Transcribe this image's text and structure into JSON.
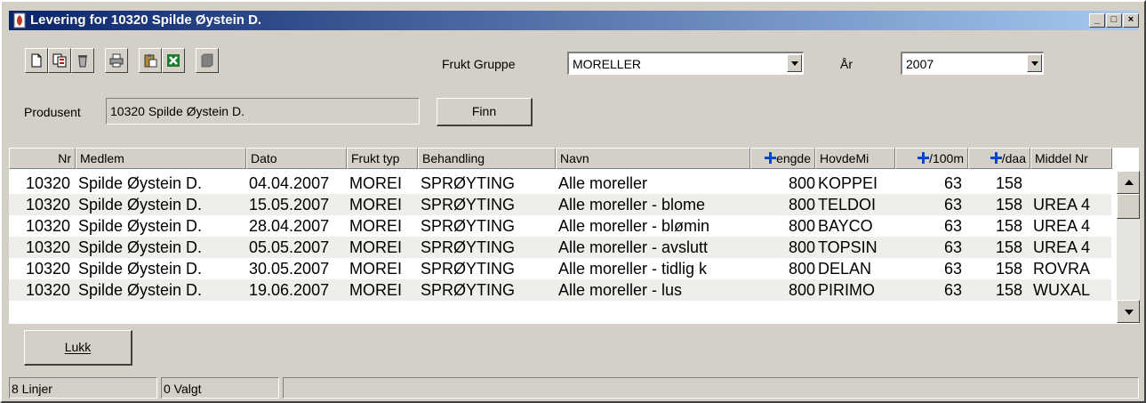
{
  "window": {
    "title": "Levering for 10320 Spilde Øystein D."
  },
  "toolbar": {
    "icons": [
      "new-document-icon",
      "copy-icon",
      "delete-icon",
      "print-icon",
      "paste-icon",
      "excel-icon",
      "stop-icon"
    ]
  },
  "filters": {
    "frukt_gruppe_label": "Frukt Gruppe",
    "frukt_gruppe_value": "MORELLER",
    "aar_label": "År",
    "aar_value": "2007",
    "produsent_label": "Produsent",
    "produsent_value": "10320 Spilde Øystein D.",
    "finn_label": "Finn"
  },
  "grid": {
    "columns": [
      "Nr",
      "Medlem",
      "Dato",
      "Frukt typ",
      "Behandling",
      "Navn",
      "engde",
      "HovdeMi",
      "/100m",
      "/daa",
      "Middel Nr"
    ],
    "rows": [
      [
        "10320",
        "Spilde Øystein D.",
        "04.04.2007",
        "MOREI",
        "SPRØYTING",
        "Alle moreller",
        "800",
        "KOPPEI",
        "63",
        "158",
        ""
      ],
      [
        "10320",
        "Spilde Øystein D.",
        "15.05.2007",
        "MOREI",
        "SPRØYTING",
        "Alle moreller - blome",
        "800",
        "TELDOI",
        "63",
        "158",
        "UREA 4"
      ],
      [
        "10320",
        "Spilde Øystein D.",
        "28.04.2007",
        "MOREI",
        "SPRØYTING",
        "Alle moreller - blømin",
        "800",
        "BAYCO",
        "63",
        "158",
        "UREA 4"
      ],
      [
        "10320",
        "Spilde Øystein D.",
        "05.05.2007",
        "MOREI",
        "SPRØYTING",
        "Alle moreller - avslutt",
        "800",
        "TOPSIN",
        "63",
        "158",
        "UREA 4"
      ],
      [
        "10320",
        "Spilde Øystein D.",
        "30.05.2007",
        "MOREI",
        "SPRØYTING",
        "Alle moreller - tidlig k",
        "800",
        "DELAN",
        "63",
        "158",
        "ROVRA"
      ],
      [
        "10320",
        "Spilde Øystein D.",
        "19.06.2007",
        "MOREI",
        "SPRØYTING",
        "Alle moreller - lus",
        "800",
        "PIRIMO",
        "63",
        "158",
        "WUXAL"
      ]
    ]
  },
  "actions": {
    "lukk_label": "Lukk"
  },
  "status": {
    "lines": "8 Linjer",
    "selected": "0 Valgt"
  }
}
